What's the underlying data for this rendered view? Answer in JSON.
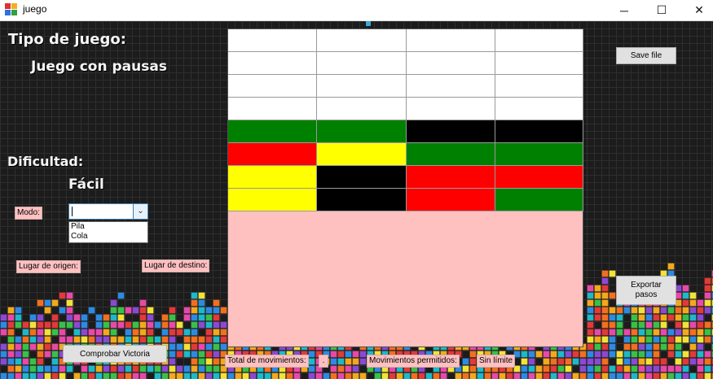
{
  "window": {
    "title": "juego",
    "controls": {
      "minimize": "─",
      "maximize": "☐",
      "close": "✕"
    }
  },
  "left_panel": {
    "tipo_label": "Tipo de juego:",
    "tipo_value": "Juego con pausas",
    "dificultad_label": "Dificultad:",
    "dificultad_value": "Fácil",
    "modo_label": "Modo:",
    "modo_select": {
      "value": "",
      "options": [
        "Pila",
        "Cola"
      ]
    },
    "origen_label": "Lugar de origen:",
    "destino_label": "Lugar de destino:"
  },
  "buttons": {
    "save_file": "Save file",
    "exportar_pasos": "Exportar pasos",
    "comprobar_victoria": "Comprobar Victoria"
  },
  "status_bar": {
    "total_label": "Total de movimientos:",
    "total_value": ".",
    "permitidos_label": "Movimientos permitidos:",
    "permitidos_value": "Sin límite"
  },
  "board": {
    "columns": 4,
    "rows": [
      [
        "white",
        "white",
        "white",
        "white"
      ],
      [
        "white",
        "white",
        "white",
        "white"
      ],
      [
        "white",
        "white",
        "white",
        "white"
      ],
      [
        "white",
        "white",
        "white",
        "white"
      ],
      [
        "green",
        "green",
        "black",
        "black"
      ],
      [
        "red",
        "yellow",
        "green",
        "green"
      ],
      [
        "yellow",
        "black",
        "red",
        "red"
      ],
      [
        "yellow",
        "black",
        "red",
        "green"
      ]
    ]
  },
  "colors": {
    "white": "#ffffff",
    "green": "#008000",
    "black": "#000000",
    "red": "#ff0000",
    "yellow": "#ffff00",
    "panel_pink": "#ffc0c0"
  },
  "icons": {
    "app": "tetris-block-icon",
    "dropdown": "chevron-down-icon"
  }
}
